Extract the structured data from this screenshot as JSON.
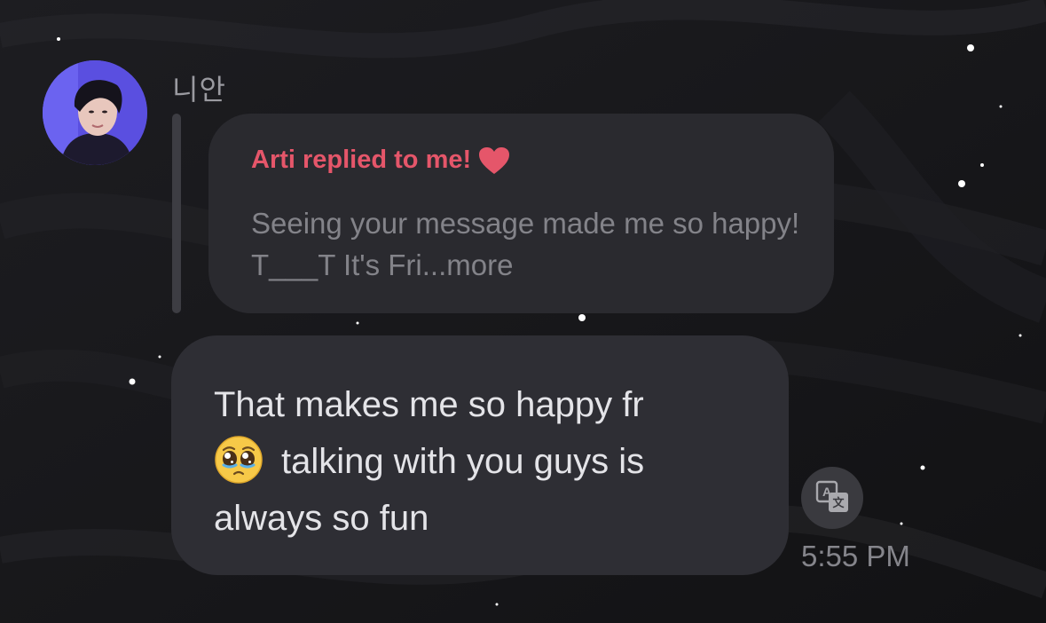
{
  "sender": {
    "name": "니안",
    "avatar_icon": "profile-photo"
  },
  "reply": {
    "title": "Arti replied to me!",
    "heart_color": "#e5566a",
    "quoted_text": "Seeing your message made me so happy! T___T It's Fri...",
    "more_label": "more"
  },
  "message": {
    "line1": "That makes me so happy fr",
    "line2": "talking with you guys is",
    "line3": "always so fun",
    "emoji": "pleading-face-emoji",
    "time": "5:55 PM"
  },
  "translate": {
    "icon": "translate-icon"
  },
  "colors": {
    "background": "#17171a",
    "bubble": "#2e2e34",
    "accent": "#e5566a"
  }
}
